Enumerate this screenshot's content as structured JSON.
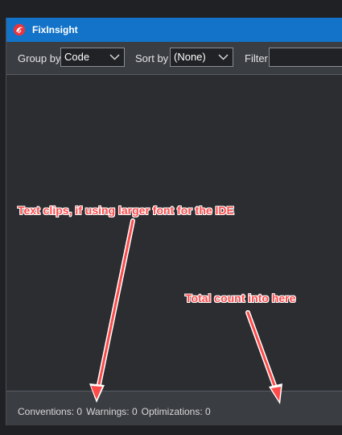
{
  "window": {
    "title": "FixInsight",
    "title_bar_color": "#1273c9",
    "accent_icon": "fixinsight-logo-icon"
  },
  "toolbar": {
    "group_by_label": "Group by",
    "group_by_value": "Code",
    "sort_by_label": "Sort by",
    "sort_by_value": "(None)",
    "filter_label": "Filter",
    "filter_value": "",
    "chevron_icon": "chevron-down-icon"
  },
  "status": {
    "conventions": "Conventions: 0",
    "warnings": "Warnings: 0",
    "optimizations": "Optimizations: 0"
  },
  "annotations": {
    "text_clips": "Text clips, if using larger font for the IDE",
    "total_count": "Total count into here",
    "color": "#ff4a4a",
    "outline_color": "#ffffff"
  }
}
